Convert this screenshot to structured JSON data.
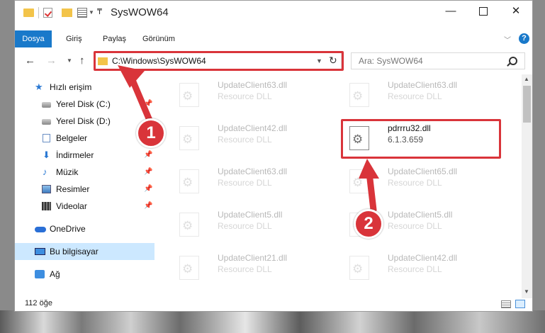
{
  "window": {
    "title": "SysWOW64",
    "minimize": "—",
    "close": "✕"
  },
  "ribbon": {
    "tabs": [
      "Dosya",
      "Giriş",
      "Paylaş",
      "Görünüm"
    ],
    "help": "?"
  },
  "nav": {
    "address": "C:\\Windows\\SysWOW64",
    "search_placeholder": "Ara: SysWOW64"
  },
  "sidebar": {
    "items": [
      {
        "label": "Hızlı erişim",
        "icon": "star-icon"
      },
      {
        "label": "Yerel Disk (C:)",
        "icon": "drive-icon",
        "pinned": true
      },
      {
        "label": "Yerel Disk (D:)",
        "icon": "drive-icon"
      },
      {
        "label": "Belgeler",
        "icon": "documents-icon"
      },
      {
        "label": "İndirmeler",
        "icon": "downloads-icon",
        "pinned": true
      },
      {
        "label": "Müzik",
        "icon": "music-icon",
        "pinned": true
      },
      {
        "label": "Resimler",
        "icon": "pictures-icon",
        "pinned": true
      },
      {
        "label": "Videolar",
        "icon": "videos-icon",
        "pinned": true
      },
      {
        "label": "OneDrive",
        "icon": "cloud-icon"
      },
      {
        "label": "Bu bilgisayar",
        "icon": "computer-icon",
        "selected": true
      },
      {
        "label": "Ağ",
        "icon": "network-icon"
      }
    ]
  },
  "files": [
    {
      "name": "UpdateClient63.dll",
      "desc": "Resource DLL"
    },
    {
      "name": "UpdateClient63.dll",
      "desc": "Resource DLL"
    },
    {
      "name": "UpdateClient42.dll",
      "desc": "Resource DLL"
    },
    {
      "name": "pdrrru32.dll",
      "desc": "6.1.3.659",
      "highlighted": true
    },
    {
      "name": "UpdateClient63.dll",
      "desc": "Resource DLL"
    },
    {
      "name": "UpdateClient65.dll",
      "desc": "Resource DLL"
    },
    {
      "name": "UpdateClient5.dll",
      "desc": "Resource DLL"
    },
    {
      "name": "UpdateClient5.dll",
      "desc": "Resource DLL"
    },
    {
      "name": "UpdateClient21.dll",
      "desc": "Resource DLL"
    },
    {
      "name": "UpdateClient42.dll",
      "desc": "Resource DLL"
    }
  ],
  "status": {
    "count": "112 öğe"
  },
  "callouts": {
    "step1": "1",
    "step2": "2"
  },
  "colors": {
    "accent": "#1979ca",
    "highlight": "#d9343a",
    "selected_bg": "#cce8ff"
  }
}
